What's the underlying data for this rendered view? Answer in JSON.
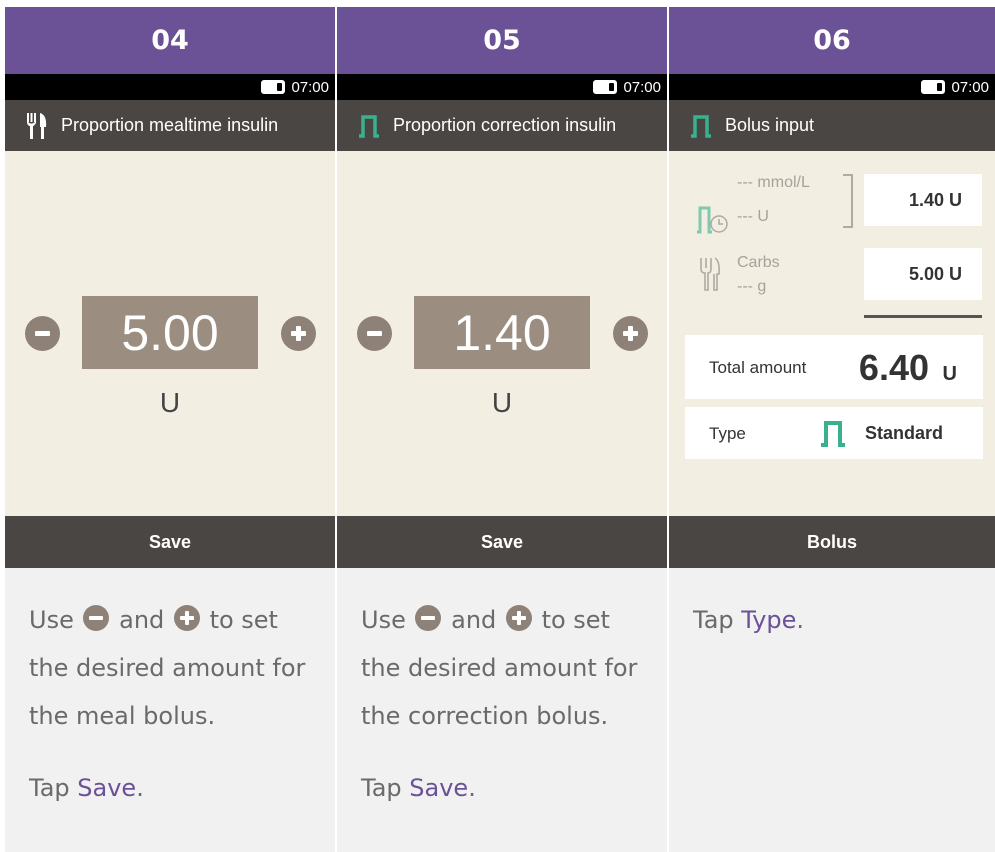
{
  "status": {
    "time": "07:00"
  },
  "steps": [
    {
      "number": "04",
      "title": "Proportion mealtime insulin",
      "title_icon": "fork-knife-icon",
      "value": "5.00",
      "unit": "U",
      "action": "Save",
      "instructions": {
        "use": "Use",
        "and": "and",
        "to_set": "to set",
        "line2": "the desired amount for",
        "line3": "the meal bolus.",
        "tap": "Tap",
        "link": "Save",
        "period": "."
      }
    },
    {
      "number": "05",
      "title": "Proportion correction insulin",
      "title_icon": "standard-bolus-icon",
      "value": "1.40",
      "unit": "U",
      "action": "Save",
      "instructions": {
        "use": "Use",
        "and": "and",
        "to_set": "to set",
        "line2": "the desired amount for",
        "line3": "the correction bolus.",
        "tap": "Tap",
        "link": "Save",
        "period": "."
      }
    },
    {
      "number": "06",
      "title": "Bolus input",
      "title_icon": "standard-bolus-icon",
      "bg_mmol": "--- mmol/L",
      "bg_units": "--- U",
      "correction_value": "1.40 U",
      "carbs_label": "Carbs",
      "carbs_g": "--- g",
      "carbs_value": "5.00 U",
      "total_label": "Total amount",
      "total_value": "6.40",
      "total_unit": "U",
      "type_label": "Type",
      "type_value": "Standard",
      "action": "Bolus",
      "instructions": {
        "tap": "Tap",
        "link": "Type",
        "period": "."
      }
    }
  ],
  "colors": {
    "header": "#6b5196",
    "dark_bar": "#4a4644",
    "screen_bg": "#f3eee2",
    "teal_icon": "#3bb08f",
    "value_box": "#9b8e81"
  }
}
